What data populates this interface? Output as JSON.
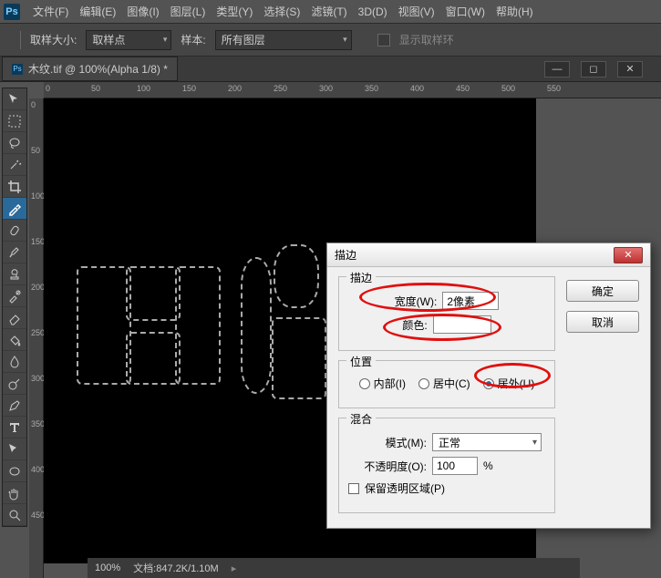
{
  "menu": {
    "items": [
      "文件(F)",
      "编辑(E)",
      "图像(I)",
      "图层(L)",
      "类型(Y)",
      "选择(S)",
      "滤镜(T)",
      "3D(D)",
      "视图(V)",
      "窗口(W)",
      "帮助(H)"
    ]
  },
  "options": {
    "sample_size_label": "取样大小:",
    "sample_size_value": "取样点",
    "sample_label": "样本:",
    "sample_value": "所有图层",
    "show_ring_label": "显示取样环"
  },
  "doc": {
    "title": "木纹.tif @ 100%(Alpha 1/8) *"
  },
  "ruler": {
    "h": [
      "0",
      "50",
      "100",
      "150",
      "200",
      "250",
      "300",
      "350",
      "400",
      "450",
      "500",
      "550"
    ],
    "v": [
      "0",
      "50",
      "100",
      "150",
      "200",
      "250",
      "300",
      "350",
      "400",
      "450"
    ]
  },
  "dialog": {
    "title": "描边",
    "ok": "确定",
    "cancel": "取消",
    "group_stroke": "描边",
    "width_label": "宽度(W):",
    "width_value": "2像素",
    "color_label": "颜色:",
    "group_position": "位置",
    "pos_inside": "内部(I)",
    "pos_center": "居中(C)",
    "pos_outside": "居外(U)",
    "group_blend": "混合",
    "mode_label": "模式(M):",
    "mode_value": "正常",
    "opacity_label": "不透明度(O):",
    "opacity_value": "100",
    "opacity_suffix": "%",
    "preserve_label": "保留透明区域(P)"
  },
  "status": {
    "zoom": "100%",
    "docsize_label": "文档:",
    "docsize": "847.2K/1.10M"
  },
  "icons": {
    "move": "move-icon",
    "marquee": "marquee-icon",
    "lasso": "lasso-icon",
    "wand": "wand-icon",
    "crop": "crop-icon",
    "eyedrop": "eyedropper-icon",
    "heal": "heal-icon",
    "brush": "brush-icon",
    "stamp": "stamp-icon",
    "history": "history-brush-icon",
    "eraser": "eraser-icon",
    "bucket": "bucket-icon",
    "blur": "blur-icon",
    "dodge": "dodge-icon",
    "pen": "pen-icon",
    "type": "type-icon",
    "path": "path-icon",
    "shape": "shape-icon",
    "hand": "hand-icon",
    "zoom": "zoom-icon"
  }
}
